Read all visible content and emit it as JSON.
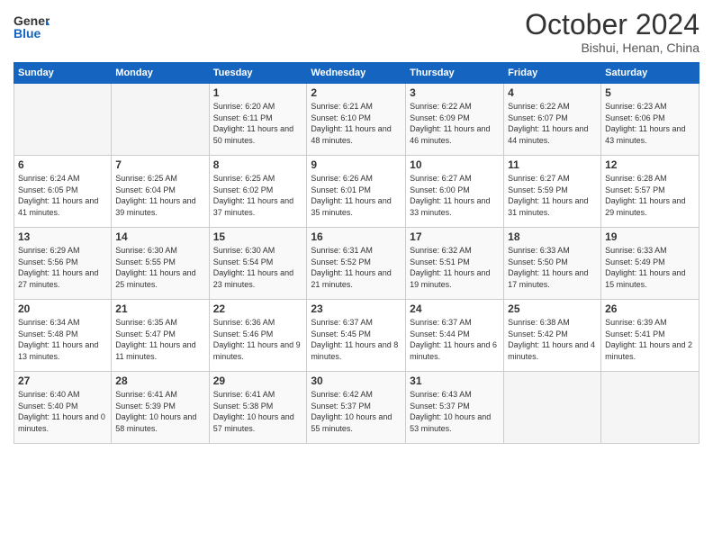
{
  "logo": {
    "text_general": "General",
    "text_blue": "Blue"
  },
  "header": {
    "month": "October 2024",
    "location": "Bishui, Henan, China"
  },
  "weekdays": [
    "Sunday",
    "Monday",
    "Tuesday",
    "Wednesday",
    "Thursday",
    "Friday",
    "Saturday"
  ],
  "weeks": [
    [
      {
        "day": "",
        "sunrise": "",
        "sunset": "",
        "daylight": ""
      },
      {
        "day": "",
        "sunrise": "",
        "sunset": "",
        "daylight": ""
      },
      {
        "day": "1",
        "sunrise": "Sunrise: 6:20 AM",
        "sunset": "Sunset: 6:11 PM",
        "daylight": "Daylight: 11 hours and 50 minutes."
      },
      {
        "day": "2",
        "sunrise": "Sunrise: 6:21 AM",
        "sunset": "Sunset: 6:10 PM",
        "daylight": "Daylight: 11 hours and 48 minutes."
      },
      {
        "day": "3",
        "sunrise": "Sunrise: 6:22 AM",
        "sunset": "Sunset: 6:09 PM",
        "daylight": "Daylight: 11 hours and 46 minutes."
      },
      {
        "day": "4",
        "sunrise": "Sunrise: 6:22 AM",
        "sunset": "Sunset: 6:07 PM",
        "daylight": "Daylight: 11 hours and 44 minutes."
      },
      {
        "day": "5",
        "sunrise": "Sunrise: 6:23 AM",
        "sunset": "Sunset: 6:06 PM",
        "daylight": "Daylight: 11 hours and 43 minutes."
      }
    ],
    [
      {
        "day": "6",
        "sunrise": "Sunrise: 6:24 AM",
        "sunset": "Sunset: 6:05 PM",
        "daylight": "Daylight: 11 hours and 41 minutes."
      },
      {
        "day": "7",
        "sunrise": "Sunrise: 6:25 AM",
        "sunset": "Sunset: 6:04 PM",
        "daylight": "Daylight: 11 hours and 39 minutes."
      },
      {
        "day": "8",
        "sunrise": "Sunrise: 6:25 AM",
        "sunset": "Sunset: 6:02 PM",
        "daylight": "Daylight: 11 hours and 37 minutes."
      },
      {
        "day": "9",
        "sunrise": "Sunrise: 6:26 AM",
        "sunset": "Sunset: 6:01 PM",
        "daylight": "Daylight: 11 hours and 35 minutes."
      },
      {
        "day": "10",
        "sunrise": "Sunrise: 6:27 AM",
        "sunset": "Sunset: 6:00 PM",
        "daylight": "Daylight: 11 hours and 33 minutes."
      },
      {
        "day": "11",
        "sunrise": "Sunrise: 6:27 AM",
        "sunset": "Sunset: 5:59 PM",
        "daylight": "Daylight: 11 hours and 31 minutes."
      },
      {
        "day": "12",
        "sunrise": "Sunrise: 6:28 AM",
        "sunset": "Sunset: 5:57 PM",
        "daylight": "Daylight: 11 hours and 29 minutes."
      }
    ],
    [
      {
        "day": "13",
        "sunrise": "Sunrise: 6:29 AM",
        "sunset": "Sunset: 5:56 PM",
        "daylight": "Daylight: 11 hours and 27 minutes."
      },
      {
        "day": "14",
        "sunrise": "Sunrise: 6:30 AM",
        "sunset": "Sunset: 5:55 PM",
        "daylight": "Daylight: 11 hours and 25 minutes."
      },
      {
        "day": "15",
        "sunrise": "Sunrise: 6:30 AM",
        "sunset": "Sunset: 5:54 PM",
        "daylight": "Daylight: 11 hours and 23 minutes."
      },
      {
        "day": "16",
        "sunrise": "Sunrise: 6:31 AM",
        "sunset": "Sunset: 5:52 PM",
        "daylight": "Daylight: 11 hours and 21 minutes."
      },
      {
        "day": "17",
        "sunrise": "Sunrise: 6:32 AM",
        "sunset": "Sunset: 5:51 PM",
        "daylight": "Daylight: 11 hours and 19 minutes."
      },
      {
        "day": "18",
        "sunrise": "Sunrise: 6:33 AM",
        "sunset": "Sunset: 5:50 PM",
        "daylight": "Daylight: 11 hours and 17 minutes."
      },
      {
        "day": "19",
        "sunrise": "Sunrise: 6:33 AM",
        "sunset": "Sunset: 5:49 PM",
        "daylight": "Daylight: 11 hours and 15 minutes."
      }
    ],
    [
      {
        "day": "20",
        "sunrise": "Sunrise: 6:34 AM",
        "sunset": "Sunset: 5:48 PM",
        "daylight": "Daylight: 11 hours and 13 minutes."
      },
      {
        "day": "21",
        "sunrise": "Sunrise: 6:35 AM",
        "sunset": "Sunset: 5:47 PM",
        "daylight": "Daylight: 11 hours and 11 minutes."
      },
      {
        "day": "22",
        "sunrise": "Sunrise: 6:36 AM",
        "sunset": "Sunset: 5:46 PM",
        "daylight": "Daylight: 11 hours and 9 minutes."
      },
      {
        "day": "23",
        "sunrise": "Sunrise: 6:37 AM",
        "sunset": "Sunset: 5:45 PM",
        "daylight": "Daylight: 11 hours and 8 minutes."
      },
      {
        "day": "24",
        "sunrise": "Sunrise: 6:37 AM",
        "sunset": "Sunset: 5:44 PM",
        "daylight": "Daylight: 11 hours and 6 minutes."
      },
      {
        "day": "25",
        "sunrise": "Sunrise: 6:38 AM",
        "sunset": "Sunset: 5:42 PM",
        "daylight": "Daylight: 11 hours and 4 minutes."
      },
      {
        "day": "26",
        "sunrise": "Sunrise: 6:39 AM",
        "sunset": "Sunset: 5:41 PM",
        "daylight": "Daylight: 11 hours and 2 minutes."
      }
    ],
    [
      {
        "day": "27",
        "sunrise": "Sunrise: 6:40 AM",
        "sunset": "Sunset: 5:40 PM",
        "daylight": "Daylight: 11 hours and 0 minutes."
      },
      {
        "day": "28",
        "sunrise": "Sunrise: 6:41 AM",
        "sunset": "Sunset: 5:39 PM",
        "daylight": "Daylight: 10 hours and 58 minutes."
      },
      {
        "day": "29",
        "sunrise": "Sunrise: 6:41 AM",
        "sunset": "Sunset: 5:38 PM",
        "daylight": "Daylight: 10 hours and 57 minutes."
      },
      {
        "day": "30",
        "sunrise": "Sunrise: 6:42 AM",
        "sunset": "Sunset: 5:37 PM",
        "daylight": "Daylight: 10 hours and 55 minutes."
      },
      {
        "day": "31",
        "sunrise": "Sunrise: 6:43 AM",
        "sunset": "Sunset: 5:37 PM",
        "daylight": "Daylight: 10 hours and 53 minutes."
      },
      {
        "day": "",
        "sunrise": "",
        "sunset": "",
        "daylight": ""
      },
      {
        "day": "",
        "sunrise": "",
        "sunset": "",
        "daylight": ""
      }
    ]
  ]
}
